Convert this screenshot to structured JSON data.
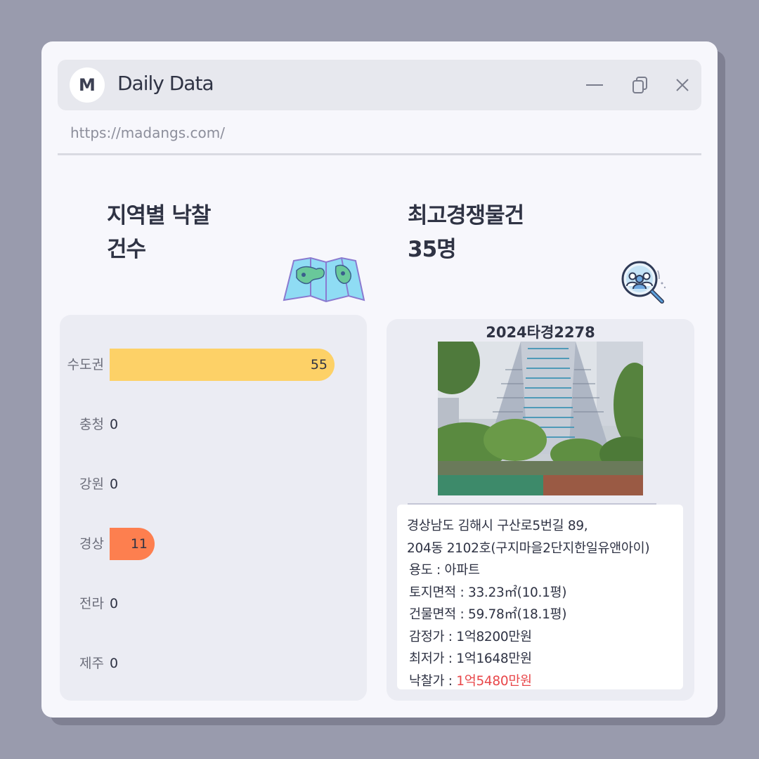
{
  "window": {
    "logo_letter": "M",
    "title": "Daily Data",
    "url": "https://madangs.com/"
  },
  "left_panel": {
    "heading_line1": "지역별 낙찰",
    "heading_line2": "건수",
    "icon": "map-icon",
    "regions": [
      {
        "label": "수도권",
        "value": 55,
        "color": "#fdd167"
      },
      {
        "label": "충청",
        "value": 0
      },
      {
        "label": "강원",
        "value": 0
      },
      {
        "label": "경상",
        "value": 11,
        "color": "#fd7f4f"
      },
      {
        "label": "전라",
        "value": 0
      },
      {
        "label": "제주",
        "value": 0
      }
    ]
  },
  "right_panel": {
    "heading_line1": "최고경쟁물건",
    "heading_line2": "35명",
    "icon": "people-search-icon",
    "case_number": "2024타경2278",
    "address_line1": "경상남도 김해시 구산로5번길 89,",
    "address_line2": "204동 2102호(구지마을2단지한일유앤아이)",
    "usage_label": "용도 : ",
    "usage": "아파트",
    "land_area_label": "토지면적 : ",
    "land_area": "33.23㎡(10.1평)",
    "building_area_label": "건물면적 : ",
    "building_area": "59.78㎡(18.1평)",
    "appraisal_label": "감정가 : ",
    "appraisal": "1억8200만원",
    "minimum_label": "최저가 : ",
    "minimum": "1억1648만원",
    "winning_label": "낙찰가 : ",
    "winning_bid": "1억5480만원",
    "winning_color": "#e8474a"
  }
}
